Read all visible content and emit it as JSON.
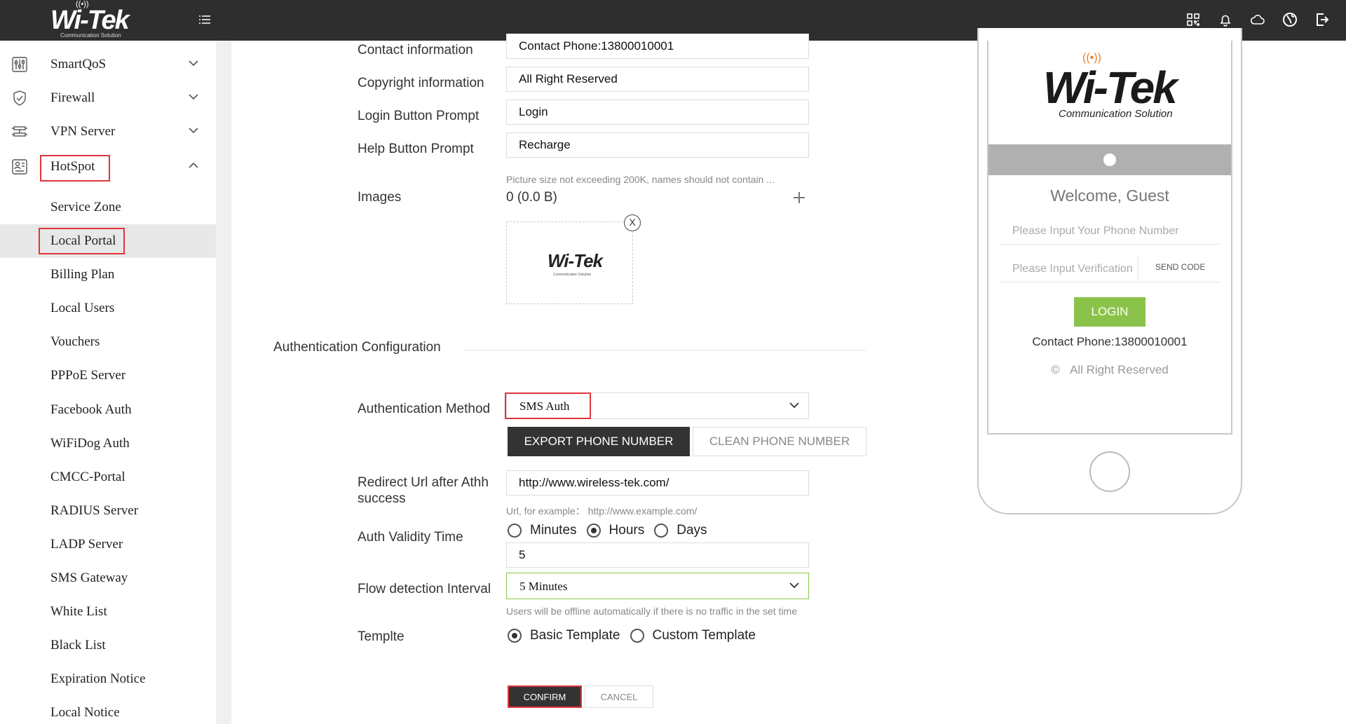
{
  "header": {
    "logo_text": "Wi-Tek",
    "logo_subtitle": "Communication Solution"
  },
  "sidebar": {
    "items": [
      {
        "label": "SmartQoS"
      },
      {
        "label": "Firewall"
      },
      {
        "label": "VPN Server"
      },
      {
        "label": "HotSpot"
      }
    ],
    "hotspot_sub": [
      {
        "label": "Service Zone"
      },
      {
        "label": "Local Portal"
      },
      {
        "label": "Billing Plan"
      },
      {
        "label": "Local Users"
      },
      {
        "label": "Vouchers"
      },
      {
        "label": "PPPoE Server"
      },
      {
        "label": "Facebook Auth"
      },
      {
        "label": "WiFiDog Auth"
      },
      {
        "label": "CMCC-Portal"
      },
      {
        "label": "RADIUS Server"
      },
      {
        "label": "LADP Server"
      },
      {
        "label": "SMS Gateway"
      },
      {
        "label": "White List"
      },
      {
        "label": "Black List"
      },
      {
        "label": "Expiration Notice"
      },
      {
        "label": "Local Notice"
      }
    ]
  },
  "form": {
    "contact_label": "Contact information",
    "contact_value": "Contact Phone:13800010001",
    "copyright_label": "Copyright information",
    "copyright_value": "All Right Reserved",
    "login_prompt_label": "Login Button Prompt",
    "login_prompt_value": "Login",
    "help_prompt_label": "Help Button Prompt",
    "help_prompt_value": "Recharge",
    "images_hint": "Picture size not exceeding 200K, names should not contain ...",
    "images_label": "Images",
    "images_value": "0 (0.0 B)",
    "image_close": "X",
    "image_thumb_text": "Wi-Tek",
    "image_thumb_sub": "Communication Solution"
  },
  "auth": {
    "section_title": "Authentication Configuration",
    "method_label": "Authentication Method",
    "method_value": "SMS Auth",
    "export_button": "EXPORT PHONE NUMBER",
    "clean_button": "CLEAN PHONE NUMBER",
    "redirect_label_1": "Redirect Url after Athh",
    "redirect_label_2": "success",
    "redirect_value": "http://www.wireless-tek.com/",
    "redirect_hint": "Url, for example： http://www.example.com/",
    "validity_label": "Auth Validity Time",
    "validity_options": [
      "Minutes",
      "Hours",
      "Days"
    ],
    "validity_selected": "Hours",
    "validity_value": "5",
    "flow_label": "Flow detection Interval",
    "flow_value": "5 Minutes",
    "flow_hint": "Users will be offline automatically if there is no traffic in the set time",
    "template_label": "Templte",
    "template_options": [
      "Basic Template",
      "Custom Template"
    ],
    "template_selected": "Basic Template",
    "confirm_button": "CONFIRM",
    "cancel_button": "CANCEL"
  },
  "preview": {
    "logo_text": "Wi-Tek",
    "logo_subtitle": "Communication Solution",
    "welcome": "Welcome, Guest",
    "phone_placeholder": "Please Input Your Phone Number",
    "code_placeholder": "Please Input Verification",
    "send_code": "SEND CODE",
    "login_button": "LOGIN",
    "contact": "Contact Phone:13800010001",
    "copyright_symbol": "©",
    "copyright": "All Right Reserved"
  },
  "colors": {
    "topbar": "#2e2e2e",
    "highlight": "#e0353b",
    "login_green": "#8bc34a",
    "brand_orange": "#f07c1e"
  }
}
